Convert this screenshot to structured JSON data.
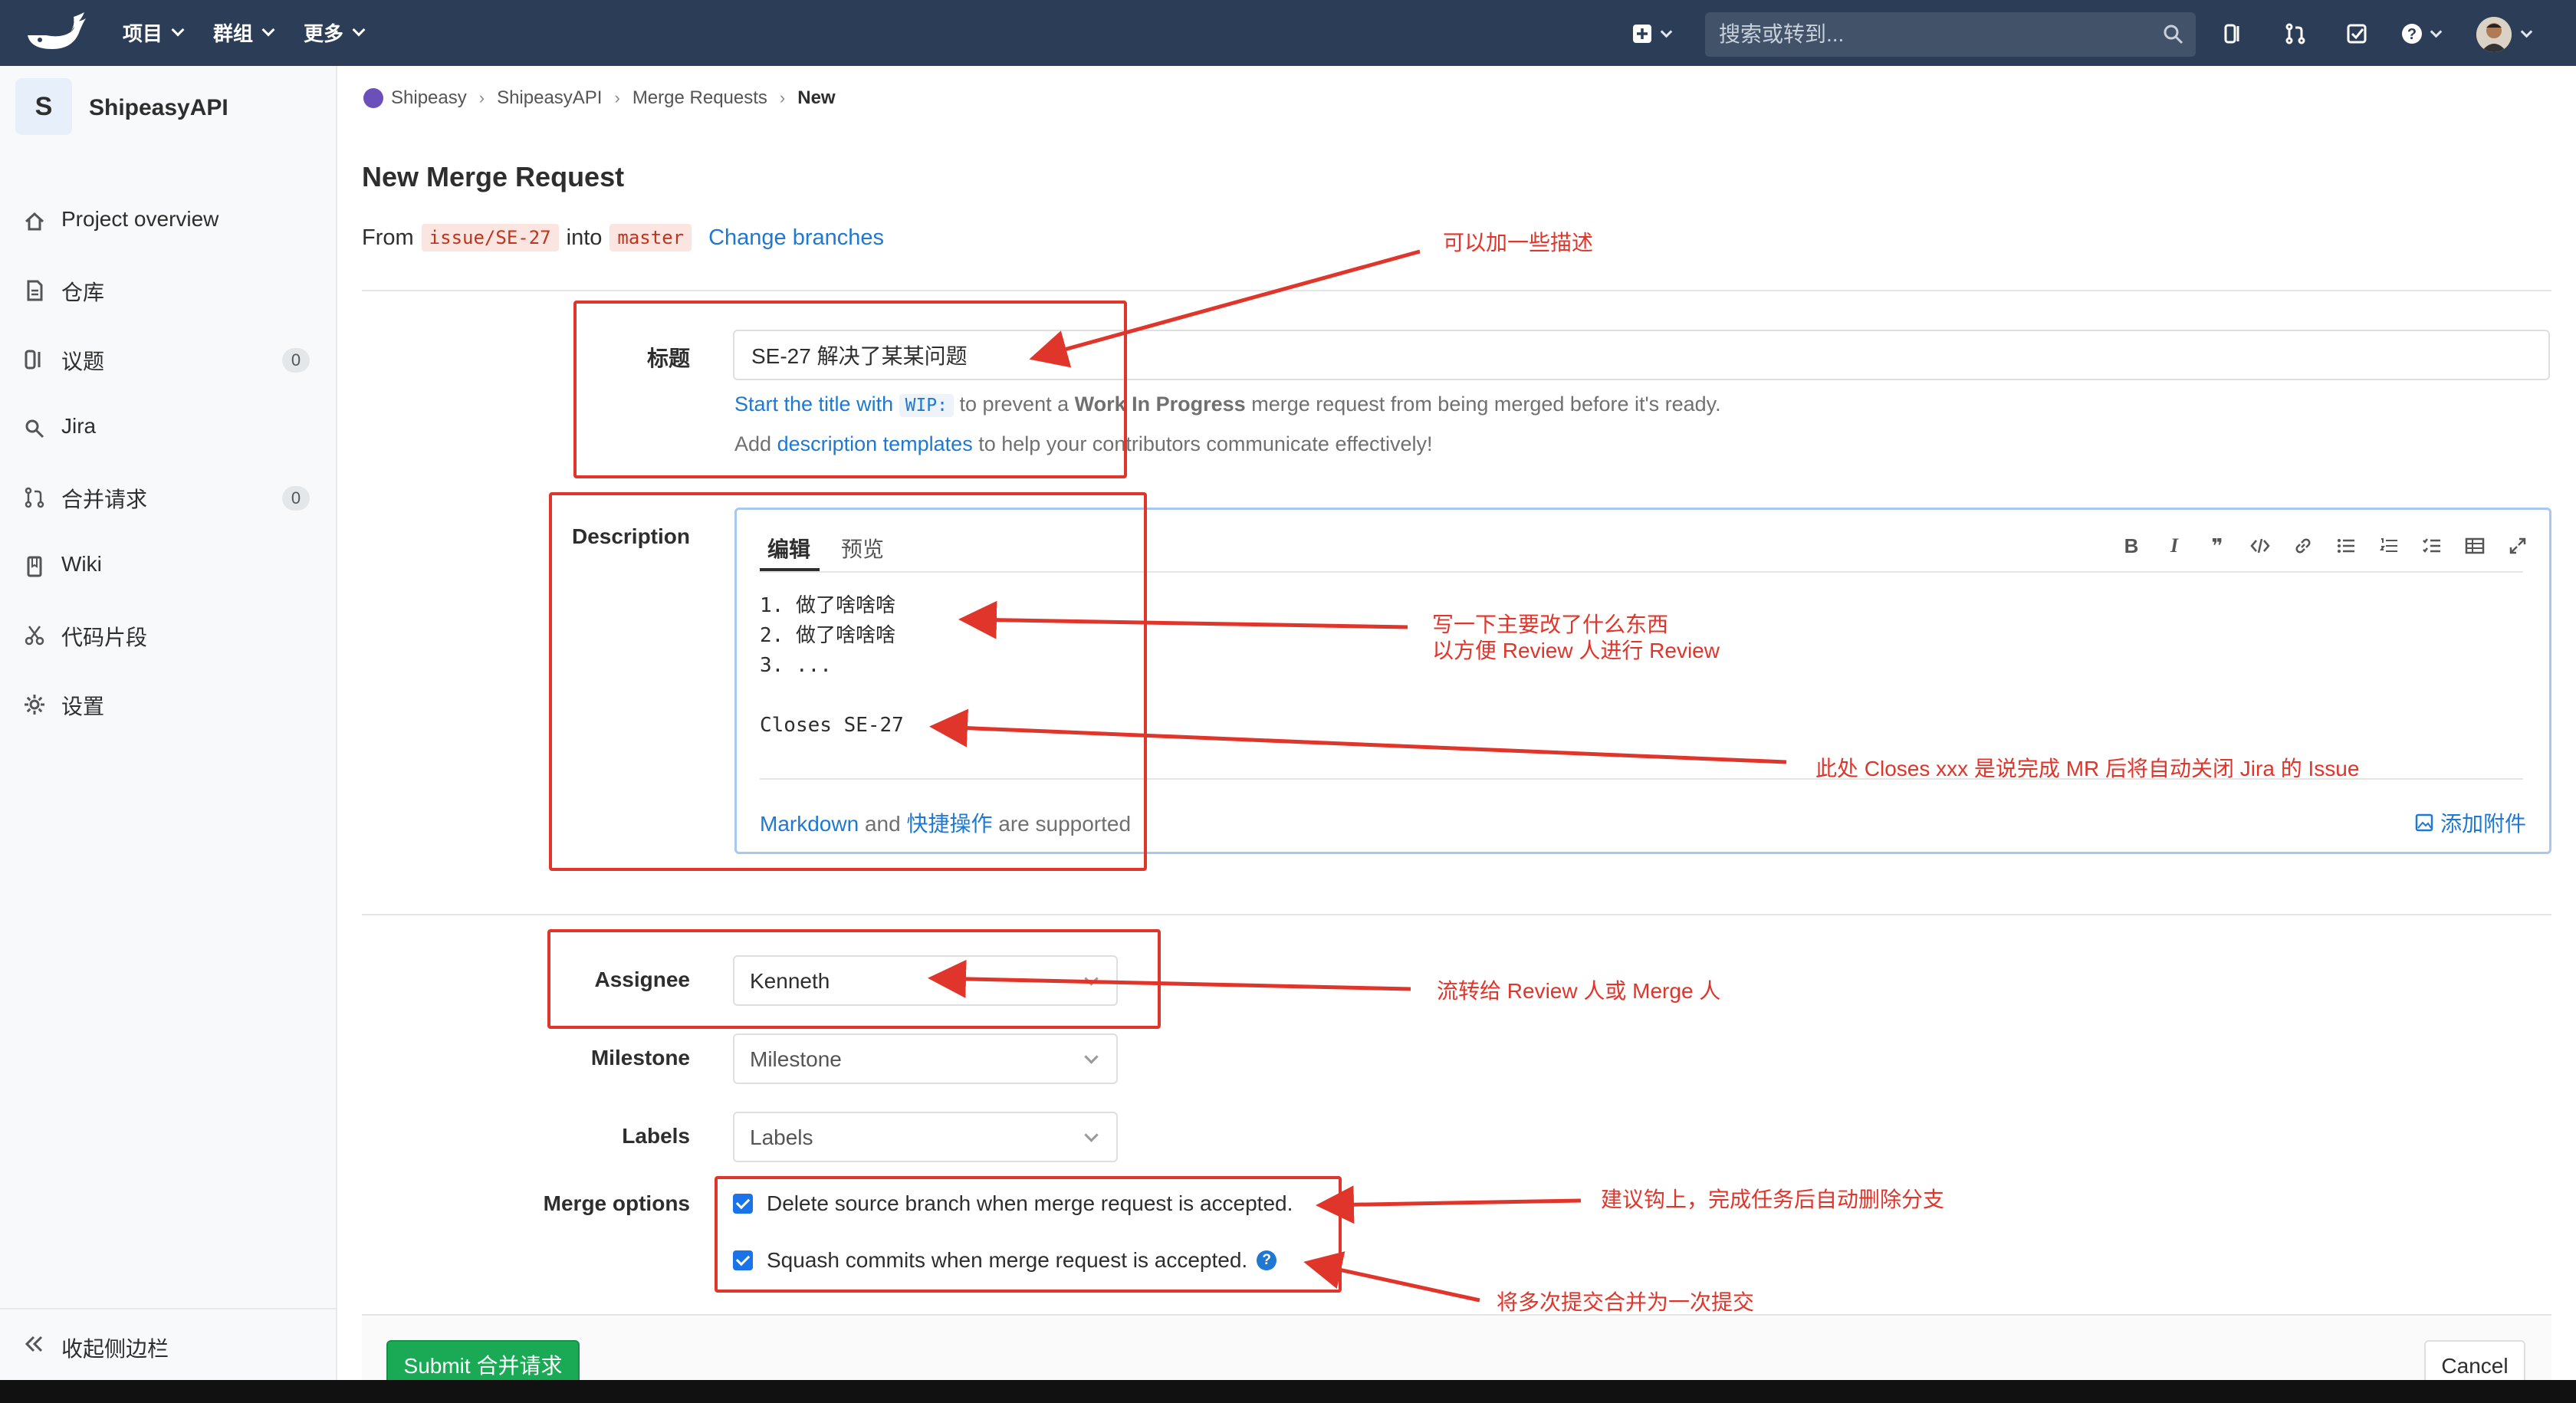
{
  "navbar": {
    "menus": [
      "项目",
      "群组",
      "更多"
    ],
    "search_placeholder": "搜索或转到..."
  },
  "sidebar": {
    "project_letter": "S",
    "project_name": "ShipeasyAPI",
    "items": [
      {
        "label": "Project overview",
        "icon": "home-icon"
      },
      {
        "label": "仓库",
        "icon": "repository-icon"
      },
      {
        "label": "议题",
        "icon": "issues-icon",
        "count": "0"
      },
      {
        "label": "Jira",
        "icon": "jira-icon"
      },
      {
        "label": "合并请求",
        "icon": "merge-request-icon",
        "count": "0"
      },
      {
        "label": "Wiki",
        "icon": "wiki-icon"
      },
      {
        "label": "代码片段",
        "icon": "snippets-icon"
      },
      {
        "label": "设置",
        "icon": "settings-icon"
      }
    ],
    "collapse_label": "收起侧边栏"
  },
  "breadcrumb": [
    "Shipeasy",
    "ShipeasyAPI",
    "Merge Requests",
    "New"
  ],
  "page": {
    "title": "New Merge Request",
    "from_label": "From",
    "source_branch": "issue/SE-27",
    "into_label": "into",
    "target_branch": "master",
    "change_branches": "Change branches"
  },
  "form": {
    "title_label": "标题",
    "title_value": "SE-27 解决了某某问题",
    "wip_hint_link": "Start the title with",
    "wip_code": "WIP:",
    "wip_hint_mid": "to prevent a",
    "wip_hint_bold": "Work In Progress",
    "wip_hint_end": "merge request from being merged before it's ready.",
    "templates_prefix": "Add",
    "templates_link": "description templates",
    "templates_suffix": "to help your contributors communicate effectively!",
    "description_label": "Description",
    "tab_write": "编辑",
    "tab_preview": "预览",
    "description_value": "1. 做了啥啥啥\n2. 做了啥啥啥\n3. ...\n\nCloses SE-27",
    "markdown_link": "Markdown",
    "and_text": "and",
    "shortcuts_link": "快捷操作",
    "supported_text": "are supported",
    "attach_label": "添加附件",
    "assignee_label": "Assignee",
    "assignee_value": "Kenneth",
    "milestone_label": "Milestone",
    "milestone_value": "Milestone",
    "labels_label": "Labels",
    "labels_value": "Labels",
    "merge_options_label": "Merge options",
    "delete_branch": "Delete source branch when merge request is accepted.",
    "squash_commits": "Squash commits when merge request is accepted.",
    "submit": "Submit 合并请求",
    "cancel": "Cancel"
  },
  "annotations": {
    "title_note": "可以加一些描述",
    "desc_note_1": "写一下主要改了什么东西",
    "desc_note_2": "以方便 Review 人进行 Review",
    "closes_note": "此处 Closes xxx 是说完成 MR 后将自动关闭 Jira 的 Issue",
    "assignee_note": "流转给 Review 人或 Merge 人",
    "delete_note": "建议钩上，完成任务后自动删除分支",
    "squash_note": "将多次提交合并为一次提交",
    "color": "#e0352b"
  },
  "colors": {
    "navbar": "#2c3e57",
    "link": "#1f78d1",
    "submit": "#1aaa55"
  }
}
